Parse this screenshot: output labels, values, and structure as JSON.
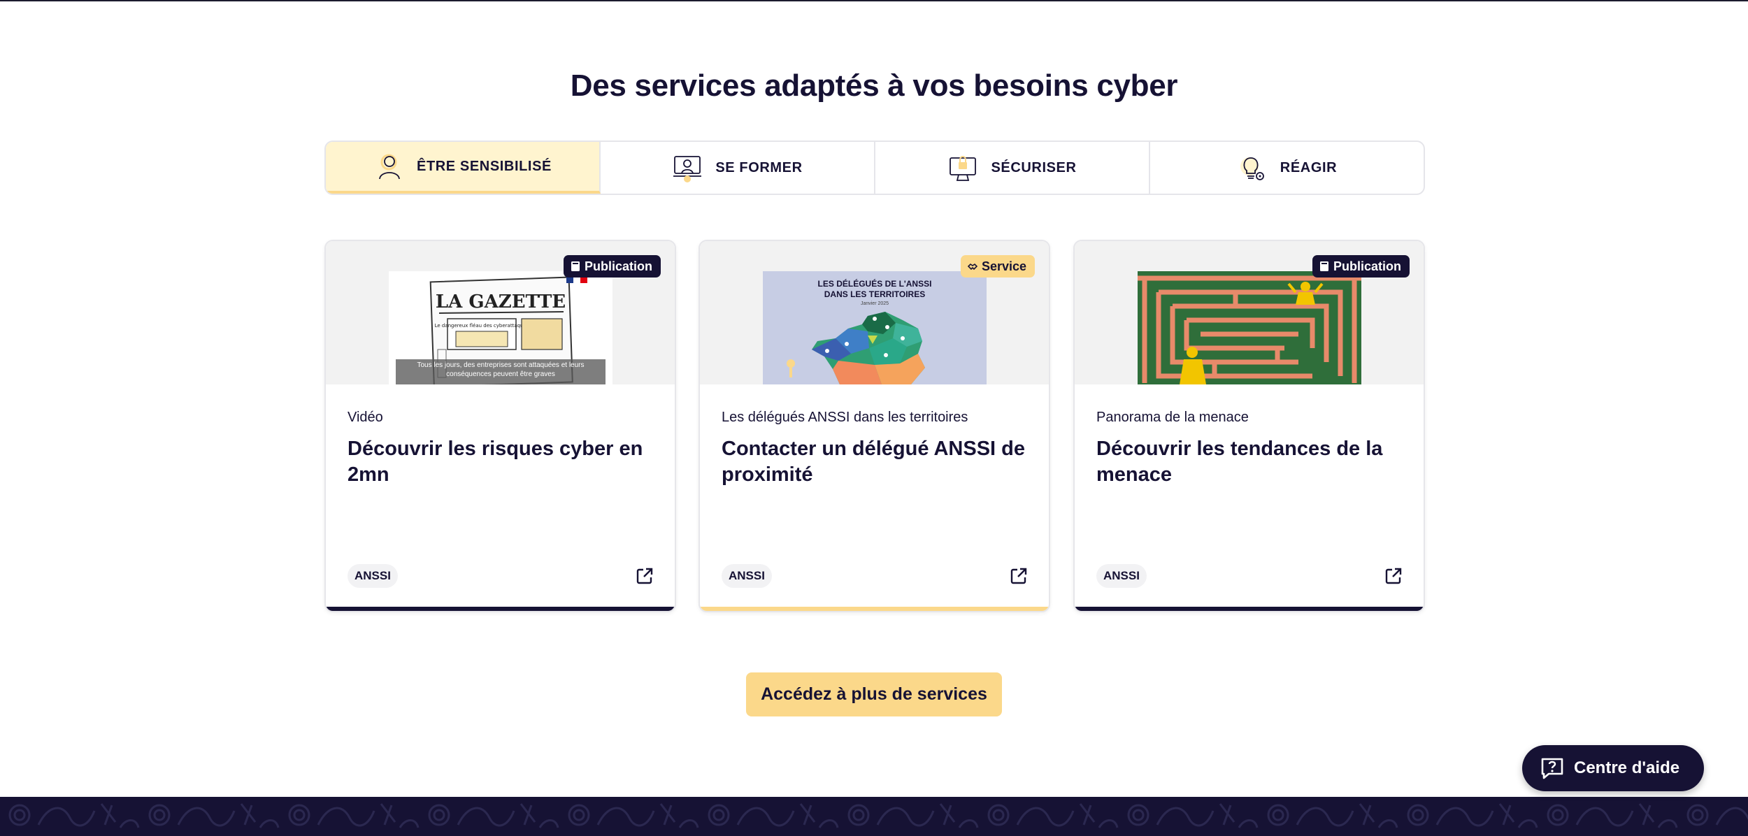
{
  "section": {
    "title": "Des services adaptés à vos besoins cyber"
  },
  "tabs": [
    {
      "label": "ÊTRE SENSIBILISÉ",
      "icon": "person-icon",
      "active": true
    },
    {
      "label": "SE FORMER",
      "icon": "training-laptop-icon",
      "active": false
    },
    {
      "label": "SÉCURISER",
      "icon": "secure-computer-icon",
      "active": false
    },
    {
      "label": "RÉAGIR",
      "icon": "lightbulb-gear-icon",
      "active": false
    }
  ],
  "cards": [
    {
      "badge": "Publication",
      "badge_icon": "book-icon",
      "kicker": "Vidéo",
      "title": "Découvrir les risques cyber en 2mn",
      "tag": "ANSSI",
      "thumb": {
        "masthead": "LA GAZETTE",
        "headline": "Le dangereux fléau des cyberattaques",
        "caption": "Tous les jours, des entreprises sont attaquées et leurs conséquences peuvent être graves"
      }
    },
    {
      "badge": "Service",
      "badge_icon": "handshake-icon",
      "kicker": "Les délégués ANSSI dans les territoires",
      "title": "Contacter un délégué ANSSI de proximité",
      "tag": "ANSSI",
      "thumb": {
        "line1": "LES DÉLÉGUÉS DE L'ANSSI",
        "line2": "DANS LES TERRITOIRES",
        "date": "Janvier 2025"
      }
    },
    {
      "badge": "Publication",
      "badge_icon": "book-icon",
      "kicker": "Panorama de la menace",
      "title": "Découvrir les tendances de la menace",
      "tag": "ANSSI"
    }
  ],
  "cta": {
    "label": "Accédez à plus de services"
  },
  "help": {
    "label": "Centre d'aide",
    "icon": "help-question-icon"
  },
  "colors": {
    "navy": "#161234",
    "accent_yellow": "#fbd88a",
    "active_tab_bg": "#fff4cf"
  }
}
